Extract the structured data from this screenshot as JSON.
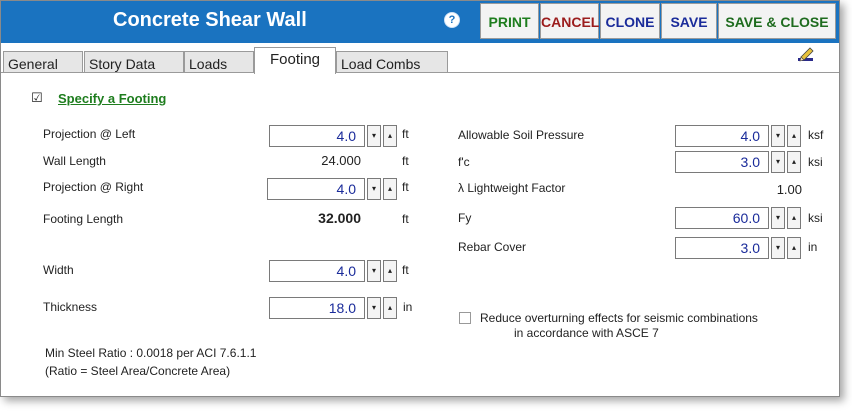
{
  "window": {
    "title": "Concrete Shear Wall"
  },
  "toolbar": {
    "help_icon": "?",
    "print": "PRINT",
    "cancel": "CANCEL",
    "clone": "CLONE",
    "save": "SAVE",
    "save_close": "SAVE & CLOSE",
    "colors": {
      "print": "#1e7d1e",
      "cancel": "#9b1c1c",
      "clone": "#1a2b9a",
      "save": "#1a2b9a",
      "save_close": "#1e6b1e"
    }
  },
  "tabs": [
    "General",
    "Story Data",
    "Loads",
    "Footing",
    "Load Combs"
  ],
  "active_tab": "Footing",
  "footing": {
    "specify_checkbox": {
      "label": "Specify a Footing",
      "checked": true,
      "check_glyph": "☑"
    },
    "left": [
      {
        "label": "Projection @ Left",
        "value": "4.0",
        "unit": "ft"
      },
      {
        "label": "Wall Length",
        "value": "24.000",
        "unit": "ft"
      },
      {
        "label": "Projection @ Right",
        "value": "4.0",
        "unit": "ft"
      },
      {
        "label": "Footing Length",
        "value": "32.000",
        "unit": "ft"
      },
      {
        "label": "Width",
        "value": "4.0",
        "unit": "ft"
      },
      {
        "label": "Thickness",
        "value": "18.0",
        "unit": "in"
      }
    ],
    "right": [
      {
        "label": "Allowable Soil Pressure",
        "value": "4.0",
        "unit": "ksf"
      },
      {
        "label": "f'c",
        "value": "3.0",
        "unit": "ksi"
      },
      {
        "label": "λ Lightweight Factor",
        "value": "1.00"
      },
      {
        "label": "Fy",
        "value": "60.0",
        "unit": "ksi"
      },
      {
        "label": "Rebar Cover",
        "value": "3.0",
        "unit": "in"
      }
    ],
    "seismic_checkbox": {
      "line1": "Reduce overturning effects for seismic combinations",
      "line2": "in accordance with ASCE 7",
      "checked": false
    },
    "notes": {
      "min_steel": "Min Steel Ratio : 0.0018 per ACI 7.6.1.1",
      "ratio": "(Ratio = Steel Area/Concrete Area)"
    }
  },
  "spinner_glyphs": {
    "down": "▾",
    "up": "▴"
  }
}
